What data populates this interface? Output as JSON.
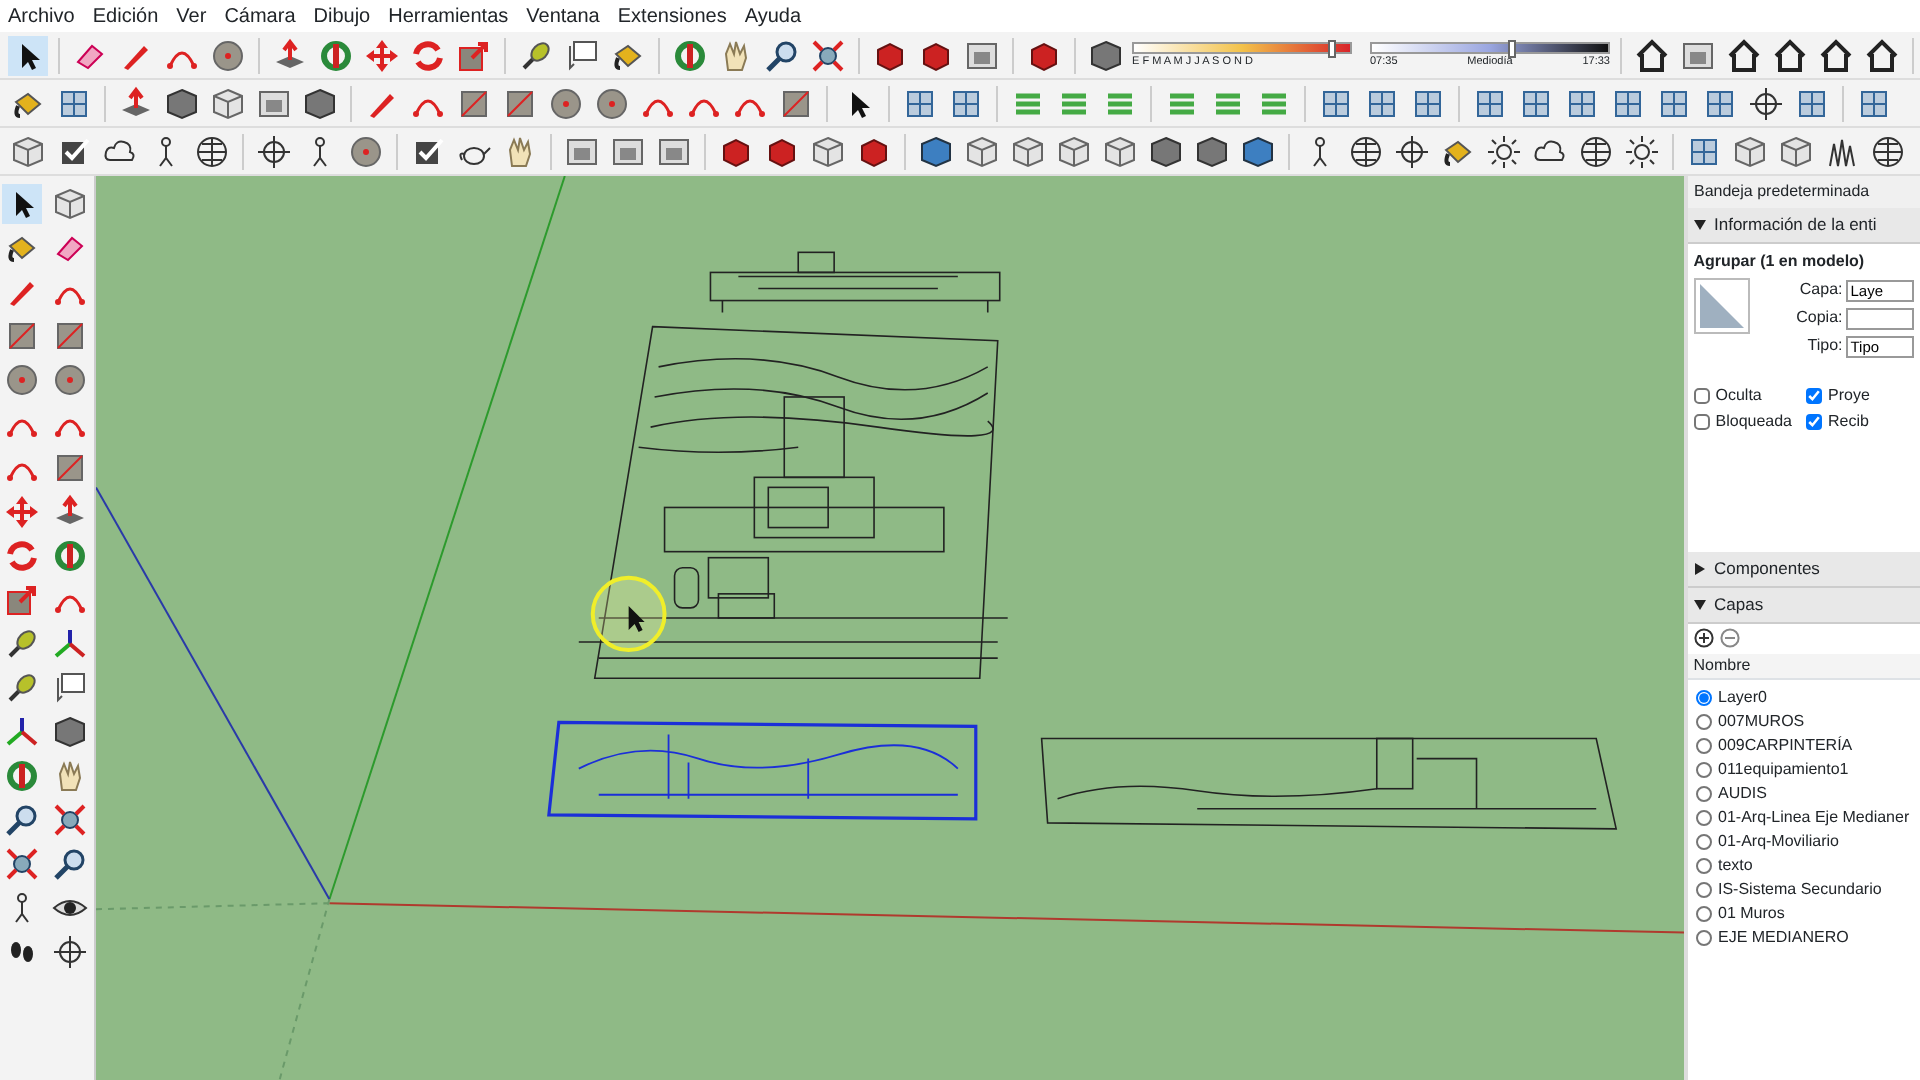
{
  "menu": [
    "Archivo",
    "Edición",
    "Ver",
    "Cámara",
    "Dibujo",
    "Herramientas",
    "Ventana",
    "Extensiones",
    "Ayuda"
  ],
  "shadow_toolbar": {
    "months": "E F M A M J J A S O N D",
    "date_slider": {
      "level": 0.9
    },
    "time_start": "07:35",
    "time_middle": "Mediodía",
    "time_end": "17:33",
    "time_slider": {
      "level": 0.58
    }
  },
  "tray": {
    "title": "Bandeja predeterminada",
    "entity_info": {
      "title": "Información de la enti",
      "expanded": true,
      "heading": "Agrupar (1 en modelo)",
      "fields": [
        {
          "label": "Capa:",
          "value": "Laye"
        },
        {
          "label": "Copia:"
        },
        {
          "label": "Tipo:",
          "value": "Tipo"
        }
      ],
      "checks": [
        {
          "label": "Oculta",
          "checked": false
        },
        {
          "label": "Proye",
          "checked": true
        },
        {
          "label": "Bloqueada",
          "checked": false
        },
        {
          "label": "Recib",
          "checked": true
        }
      ]
    },
    "components": {
      "title": "Componentes",
      "expanded": false
    },
    "layers": {
      "title": "Capas",
      "expanded": true,
      "column": "Nombre",
      "items": [
        {
          "name": "Layer0",
          "selected": true
        },
        {
          "name": "007MUROS",
          "selected": false
        },
        {
          "name": "009CARPINTERÍA",
          "selected": false
        },
        {
          "name": "011equipamiento1",
          "selected": false
        },
        {
          "name": "AUDIS",
          "selected": false
        },
        {
          "name": "01-Arq-Linea Eje Medianer",
          "selected": false
        },
        {
          "name": "01-Arq-Moviliario",
          "selected": false
        },
        {
          "name": "texto",
          "selected": false
        },
        {
          "name": "IS-Sistema Secundario",
          "selected": false
        },
        {
          "name": "01 Muros",
          "selected": false
        },
        {
          "name": "EJE MEDIANERO",
          "selected": false
        }
      ]
    }
  }
}
